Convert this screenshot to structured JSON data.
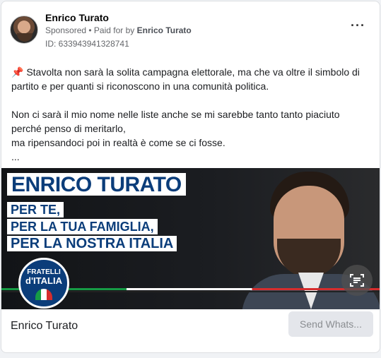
{
  "post": {
    "author": "Enrico Turato",
    "sponsored": "Sponsored",
    "paid_for_prefix": "• Paid for by",
    "paid_for_by": "Enrico Turato",
    "ad_id": "ID: 633943941328741",
    "more_icon": "more-horizontal-icon",
    "pin_icon": "📌",
    "text_lines": [
      "Stavolta non sarà la solita campagna elettorale, ma che va oltre il simbolo di partito e per quanti si riconoscono in una comunità politica.",
      "Non ci sarà il mio nome nelle liste anche se mi sarebbe tanto tanto piaciuto perché penso di meritarlo,",
      "ma ripensandoci poi in realtà è come se ci fosse.",
      "..."
    ]
  },
  "banner": {
    "title": "ENRICO TURATO",
    "line1": "PER TE,",
    "line2": "PER LA TUA FAMIGLIA,",
    "line3": "PER LA NOSTRA ITALIA",
    "logo_top": "FRATELLI",
    "logo_bottom": "d'ITALIA",
    "brand_color": "#0b3d7a"
  },
  "footer": {
    "name": "Enrico Turato",
    "cta_label": "Send Whats..."
  }
}
